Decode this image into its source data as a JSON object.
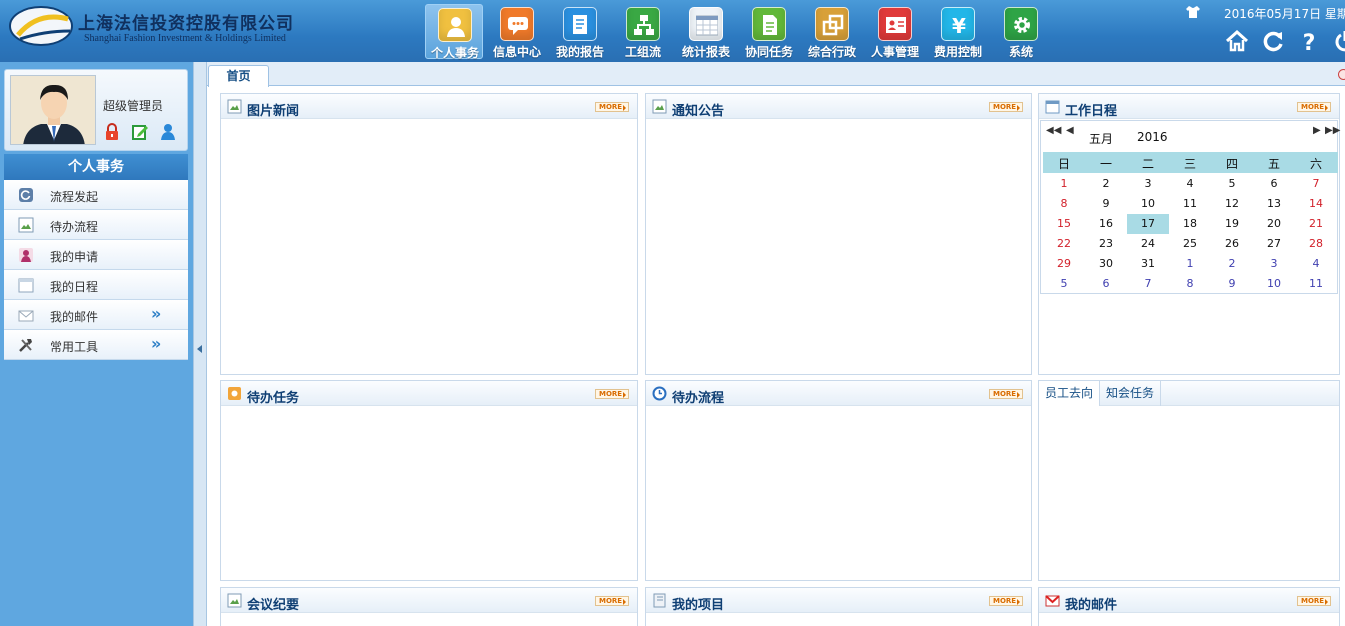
{
  "header": {
    "company_cn": "上海法信投资控股有限公司",
    "company_en": "Shanghai Fashion Investment & Holdings Limited",
    "datetime": "2016年05月17日 星期",
    "nav": [
      {
        "label": "个人事务",
        "icon": "person-icon",
        "color": "#f0c040",
        "active": true
      },
      {
        "label": "信息中心",
        "icon": "chat-icon",
        "color": "#f07a2a"
      },
      {
        "label": "我的报告",
        "icon": "report-icon",
        "color": "#2a90e0"
      },
      {
        "label": "工组流",
        "icon": "workflow-icon",
        "color": "#3aa844"
      },
      {
        "label": "统计报表",
        "icon": "calendar-table-icon",
        "color": "#eef3f8"
      },
      {
        "label": "协同任务",
        "icon": "document-icon",
        "color": "#62b83a"
      },
      {
        "label": "综合行政",
        "icon": "admin-icon",
        "color": "#d8a038"
      },
      {
        "label": "人事管理",
        "icon": "id-card-icon",
        "color": "#e03a3a"
      },
      {
        "label": "费用控制",
        "icon": "yen-icon",
        "color": "#22b6e8"
      },
      {
        "label": "系统",
        "icon": "gear-icon",
        "color": "#2ea446"
      }
    ]
  },
  "sidebar": {
    "user_name": "超级管理员",
    "section_title": "个人事务",
    "items": [
      {
        "label": "流程发起",
        "icon": "refresh-icon"
      },
      {
        "label": "待办流程",
        "icon": "picture-icon"
      },
      {
        "label": "我的申请",
        "icon": "user-icon"
      },
      {
        "label": "我的日程",
        "icon": "calendar-icon"
      },
      {
        "label": "我的邮件",
        "icon": "mail-icon",
        "arrow": "»"
      },
      {
        "label": "常用工具",
        "icon": "tools-icon",
        "arrow": "»"
      }
    ]
  },
  "tabs": {
    "home": "首页"
  },
  "panels": {
    "picture_news": "图片新闻",
    "notice": "通知公告",
    "schedule": "工作日程",
    "todo_tasks": "待办任务",
    "todo_flow": "待办流程",
    "meeting": "会议纪要",
    "my_projects": "我的项目",
    "my_mail": "我的邮件",
    "more_label": "MORE"
  },
  "staff_tabs": [
    "员工去向",
    "知会任务"
  ],
  "calendar": {
    "month": "五月",
    "year": "2016",
    "weekdays": [
      "日",
      "一",
      "二",
      "三",
      "四",
      "五",
      "六"
    ],
    "today": "17",
    "weeks": [
      [
        "1",
        "2",
        "3",
        "4",
        "5",
        "6",
        "7"
      ],
      [
        "8",
        "9",
        "10",
        "11",
        "12",
        "13",
        "14"
      ],
      [
        "15",
        "16",
        "17",
        "18",
        "19",
        "20",
        "21"
      ],
      [
        "22",
        "23",
        "24",
        "25",
        "26",
        "27",
        "28"
      ],
      [
        "29",
        "30",
        "31",
        "1",
        "2",
        "3",
        "4"
      ],
      [
        "5",
        "6",
        "7",
        "8",
        "9",
        "10",
        "11"
      ]
    ]
  }
}
